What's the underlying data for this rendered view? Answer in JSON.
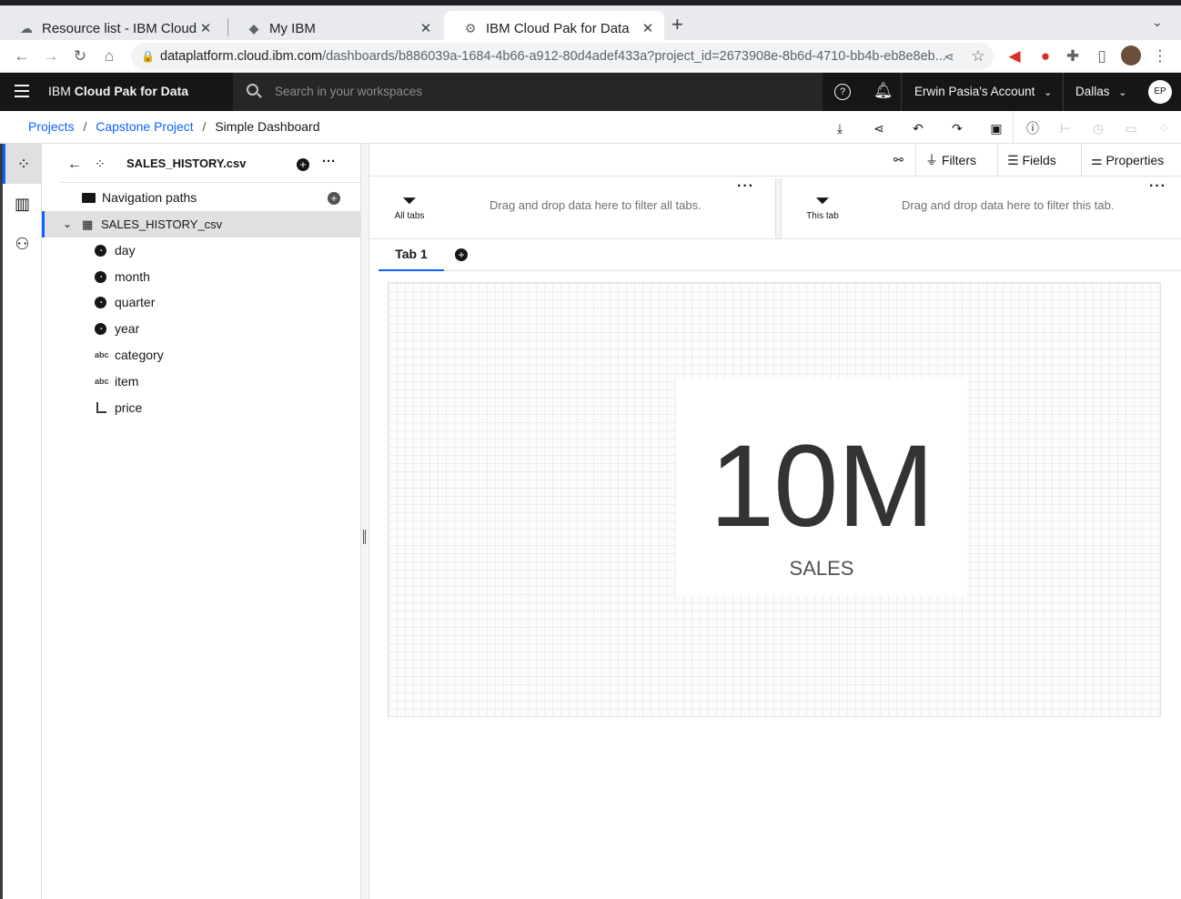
{
  "browser": {
    "tabs": [
      {
        "title": "Resource list - IBM Cloud",
        "icon": "cloud-icon",
        "active": false
      },
      {
        "title": "My IBM",
        "icon": "ibm-logo-icon",
        "active": false
      },
      {
        "title": "IBM Cloud Pak for Data",
        "icon": "cloud-pak-icon",
        "active": true
      }
    ],
    "url_host": "dataplatform.cloud.ibm.com",
    "url_path": "/dashboards/b886039a-1684-4b66-a912-80d4adef433a?project_id=2673908e-8b6d-4710-bb4b-eb8e8eb..."
  },
  "header": {
    "brand_prefix": "IBM ",
    "brand_name": "Cloud Pak for Data",
    "search_placeholder": "Search in your workspaces",
    "account": "Erwin Pasia's Account",
    "region": "Dallas",
    "avatar_initials": "EP"
  },
  "breadcrumb": {
    "items": [
      "Projects",
      "Capstone Project"
    ],
    "current": "Simple Dashboard",
    "separator": "/"
  },
  "data_panel": {
    "source_title": "SALES_HISTORY.csv",
    "nav_paths_label": "Navigation paths",
    "table_name": "SALES_HISTORY_csv",
    "fields": [
      {
        "name": "day",
        "type": "time"
      },
      {
        "name": "month",
        "type": "time"
      },
      {
        "name": "quarter",
        "type": "time"
      },
      {
        "name": "year",
        "type": "time"
      },
      {
        "name": "category",
        "type": "text",
        "badge": "abc"
      },
      {
        "name": "item",
        "type": "text",
        "badge": "abc"
      },
      {
        "name": "price",
        "type": "measure"
      }
    ]
  },
  "toolbar": {
    "filters": "Filters",
    "fields": "Fields",
    "properties": "Properties"
  },
  "filters": {
    "all_tabs_label": "All tabs",
    "all_tabs_hint": "Drag and drop data here to filter all tabs.",
    "this_tab_label": "This tab",
    "this_tab_hint": "Drag and drop data here to filter this tab."
  },
  "tabs": [
    {
      "label": "Tab 1",
      "active": true
    }
  ],
  "kpi": {
    "value": "10M",
    "label": "SALES"
  },
  "colors": {
    "accent": "#0f62fe",
    "header_bg": "#161616"
  }
}
